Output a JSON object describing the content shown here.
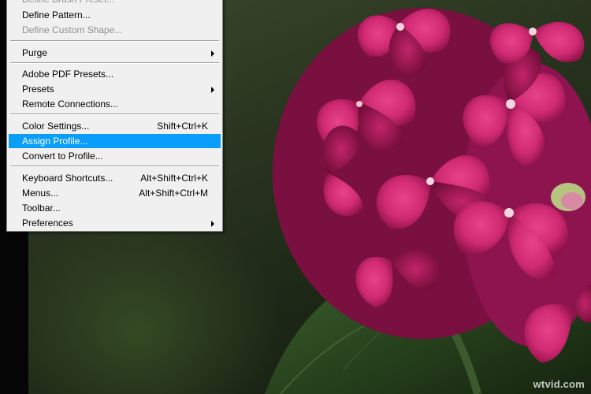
{
  "menu": {
    "highlight_color": "#0a9dfa",
    "items": [
      {
        "label": "Define Brush Preset...",
        "enabled": false
      },
      {
        "label": "Define Pattern...",
        "enabled": true
      },
      {
        "label": "Define Custom Shape...",
        "enabled": false
      },
      {
        "label": "Purge",
        "submenu": true
      },
      {
        "label": "Adobe PDF Presets..."
      },
      {
        "label": "Presets",
        "submenu": true
      },
      {
        "label": "Remote Connections..."
      },
      {
        "label": "Color Settings...",
        "shortcut": "Shift+Ctrl+K"
      },
      {
        "label": "Assign Profile...",
        "highlighted": true
      },
      {
        "label": "Convert to Profile..."
      },
      {
        "label": "Keyboard Shortcuts...",
        "shortcut": "Alt+Shift+Ctrl+K"
      },
      {
        "label": "Menus...",
        "shortcut": "Alt+Shift+Ctrl+M"
      },
      {
        "label": "Toolbar..."
      },
      {
        "label": "Preferences",
        "submenu": true
      }
    ]
  },
  "photo": {
    "subject": "pink hydrangea flowers on green background",
    "petal_color": "#d02a72",
    "leaf_color": "#2d4a22"
  },
  "watermark": "wtvid.com"
}
